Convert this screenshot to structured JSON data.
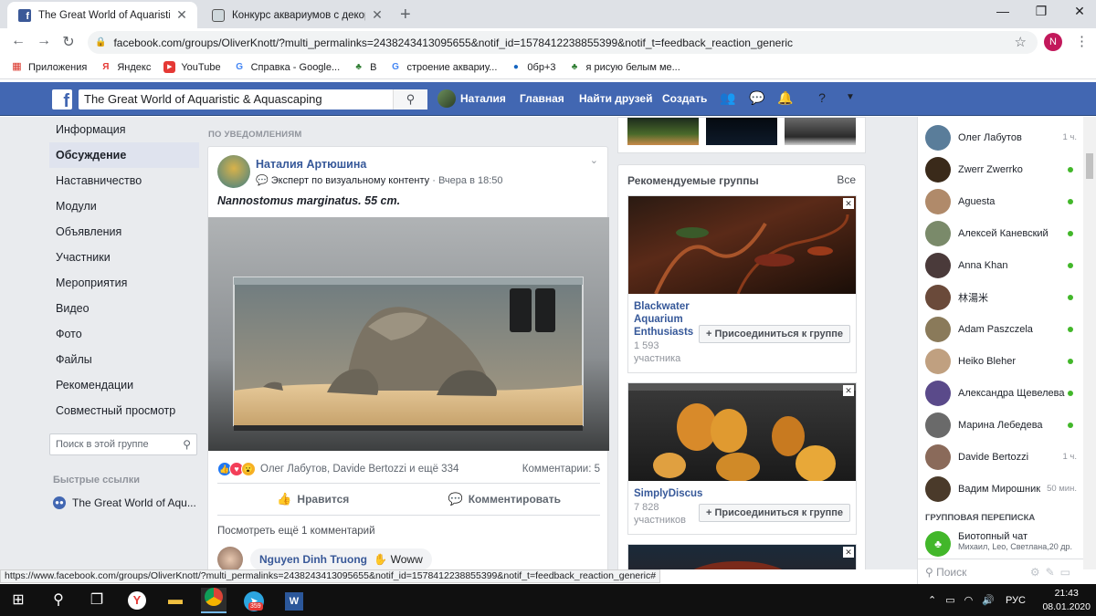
{
  "browser": {
    "tabs": [
      {
        "title": "The Great World of Aquaristic & A",
        "active": true
      },
      {
        "title": "Конкурс аквариумов с декорац",
        "active": false
      }
    ],
    "url": "facebook.com/groups/OliverKnott/?multi_permalinks=2438243413095655&notif_id=1578412238855399&notif_t=feedback_reaction_generic",
    "profile_initial": "N",
    "bookmarks": [
      "Приложения",
      "Яндекс",
      "YouTube",
      "Справка - Google...",
      "В",
      "строение аквариу...",
      "0бр+3",
      "я рисую белым ме..."
    ]
  },
  "fb": {
    "search_value": "The Great World of Aquaristic & Aquascaping",
    "user_name": "Наталия",
    "nav": {
      "home": "Главная",
      "find_friends": "Найти друзей",
      "create": "Создать"
    }
  },
  "leftnav": {
    "items": [
      "Информация",
      "Обсуждение",
      "Наставничество",
      "Модули",
      "Объявления",
      "Участники",
      "Мероприятия",
      "Видео",
      "Фото",
      "Файлы",
      "Рекомендации",
      "Совместный просмотр"
    ],
    "active_index": 1,
    "group_search_placeholder": "Поиск в этой группе",
    "quick_links_title": "Быстрые ссылки",
    "quick_link": "The Great World of Aqu..."
  },
  "feed": {
    "header": "ПО УВЕДОМЛЕНИЯМ",
    "post": {
      "author": "Наталия Артюшина",
      "badge": "Эксперт по визуальному контенту",
      "time": "· Вчера в 18:50",
      "text": "Nannostomus marginatus. 55 cm.",
      "reactions_text": "Олег Лабутов, Davide Bertozzi и ещё 334",
      "comments_count": "Комментарии: 5",
      "like_label": "Нравится",
      "comment_label": "Комментировать",
      "more_comments": "Посмотреть ещё 1 комментарий",
      "comment": {
        "name": "Nguyen Dinh Truong",
        "text": "Woww"
      }
    }
  },
  "recommended": {
    "title": "Рекомендуемые группы",
    "all": "Все",
    "join_label": "Присоединиться к группе",
    "groups": [
      {
        "name_lines": [
          "Blackwater",
          "Aquarium",
          "Enthusiasts"
        ],
        "count": "1 593",
        "count_label": "участника"
      },
      {
        "name_lines": [
          "SimplyDiscus"
        ],
        "count": "7 828",
        "count_label": "участников"
      }
    ]
  },
  "chat": {
    "contacts": [
      {
        "name": "Олег Лабутов",
        "time": "1 ч.",
        "online": false,
        "color": "#5a7d9a"
      },
      {
        "name": "Zwerr Zwerrko",
        "time": "",
        "online": true,
        "color": "#3a2a1a"
      },
      {
        "name": "Aguesta",
        "time": "",
        "online": true,
        "color": "#b08a6a"
      },
      {
        "name": "Алексей Каневский",
        "time": "",
        "online": true,
        "color": "#7a8a6a"
      },
      {
        "name": "Anna Khan",
        "time": "",
        "online": true,
        "color": "#4a3a3a"
      },
      {
        "name": "林湯米",
        "time": "",
        "online": true,
        "color": "#6a4a3a"
      },
      {
        "name": "Adam Paszczela",
        "time": "",
        "online": true,
        "color": "#8a7a5a"
      },
      {
        "name": "Heiko Bleher",
        "time": "",
        "online": true,
        "color": "#c0a080"
      },
      {
        "name": "Александра Щевелева",
        "time": "",
        "online": true,
        "color": "#5a4a8a"
      },
      {
        "name": "Марина Лебедева",
        "time": "",
        "online": true,
        "color": "#6a6a6a"
      },
      {
        "name": "Davide Bertozzi",
        "time": "1 ч.",
        "online": false,
        "color": "#8a6a5a"
      },
      {
        "name": "Вадим Мирошник",
        "time": "50 мин.",
        "online": false,
        "color": "#4a3a2a"
      }
    ],
    "group_title": "ГРУППОВАЯ ПЕРЕПИСКА",
    "group_chat_name": "Биотопный чат",
    "group_chat_members": "Михаил, Leo, Светлана,20 др.",
    "search_placeholder": "Поиск"
  },
  "status_url": "https://www.facebook.com/groups/OliverKnott/?multi_permalinks=2438243413095655&notif_id=1578412238855399&notif_t=feedback_reaction_generic#",
  "taskbar": {
    "telegram_badge": "359",
    "lang": "РУС",
    "time": "21:43",
    "date": "08.01.2020"
  }
}
